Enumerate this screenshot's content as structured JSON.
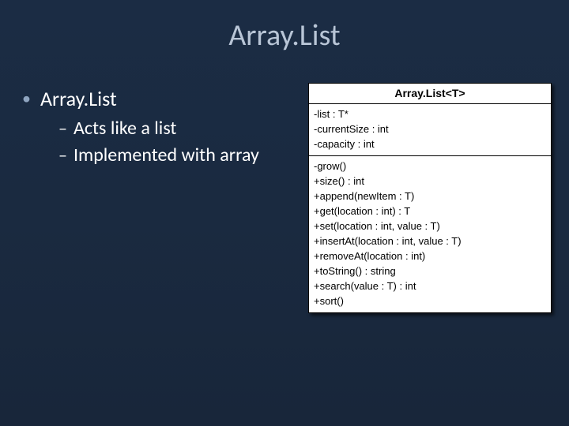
{
  "title": "Array.List",
  "bullets": {
    "main": "Array.List",
    "subs": [
      "Acts like a list",
      "Implemented with array"
    ]
  },
  "uml": {
    "className": "Array.List<T>",
    "attributes": [
      "-list : T*",
      "-currentSize : int",
      "-capacity : int"
    ],
    "operations": [
      "-grow()",
      "+size() : int",
      "+append(newItem : T)",
      "+get(location : int) : T",
      "+set(location : int, value : T)",
      "+insertAt(location : int, value : T)",
      "+removeAt(location : int)",
      "+toString() : string",
      "+search(value : T) : int",
      "+sort()"
    ]
  }
}
